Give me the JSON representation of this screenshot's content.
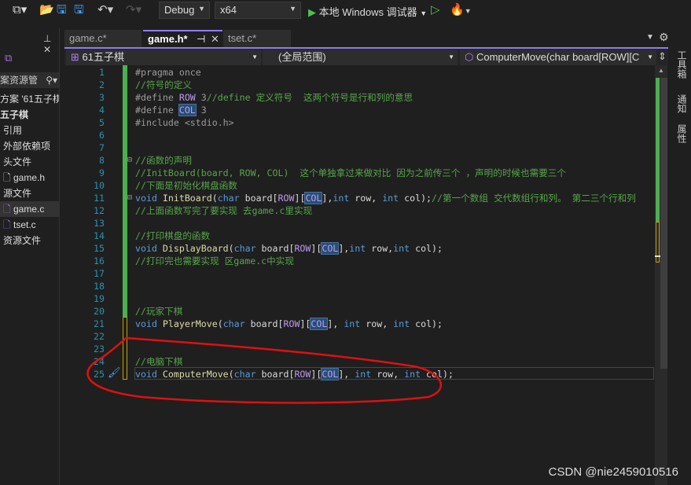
{
  "toolbar": {
    "config": "Debug",
    "platform": "x64",
    "run_label": "本地 Windows 调试器",
    "icons": [
      "new-project-icon",
      "open-folder-icon",
      "save-icon",
      "save-all-icon",
      "undo-icon",
      "redo-icon",
      "play-icon",
      "play-outline-icon",
      "hot-reload-icon"
    ]
  },
  "sidebar": {
    "search_label": "案资源管",
    "items": [
      "方案 '61五子棋",
      "五子棋",
      "引用",
      "外部依赖项",
      "头文件",
      "game.h",
      "源文件",
      "game.c",
      "tset.c",
      "资源文件"
    ]
  },
  "tabs": [
    {
      "label": "game.c*",
      "active": false
    },
    {
      "label": "game.h*",
      "active": true
    },
    {
      "label": "tset.c*",
      "active": false
    }
  ],
  "navbar": {
    "project": "61五子棋",
    "scope": "(全局范围)",
    "member": "ComputerMove(char board[ROW][C"
  },
  "right_panel": [
    "工具箱",
    "通知",
    "属性"
  ],
  "code": [
    [
      [
        "pp",
        "#pragma once"
      ]
    ],
    [
      [
        "cm",
        "//符号的定义"
      ]
    ],
    [
      [
        "pp",
        "#define "
      ],
      [
        "mac",
        "ROW"
      ],
      [
        "pp",
        " 3"
      ],
      [
        "cm",
        "//define 定义符号  这两个符号是行和列的意思"
      ]
    ],
    [
      [
        "pp",
        "#define "
      ],
      [
        "mac hl",
        "COL"
      ],
      [
        "pp",
        " 3"
      ]
    ],
    [
      [
        "pp",
        "#include <stdio.h>"
      ]
    ],
    [],
    [],
    [
      [
        "cm",
        "//函数的声明"
      ]
    ],
    [
      [
        "cm",
        "//InitBoard(board, ROW, COL)  这个单独拿过来做对比 因为之前传三个 ，声明的时候也需要三个"
      ]
    ],
    [
      [
        "cm",
        "//下面是初始化棋盘函数"
      ]
    ],
    [
      [
        "kw",
        "void "
      ],
      [
        "fn",
        "InitBoard"
      ],
      [
        "",
        "("
      ],
      [
        "kw",
        "char"
      ],
      [
        "",
        " board["
      ],
      [
        "mac",
        "ROW"
      ],
      [
        "",
        "]["
      ],
      [
        "mac hl",
        "COL"
      ],
      [
        "",
        "],"
      ],
      [
        "kw",
        "int"
      ],
      [
        "",
        " row, "
      ],
      [
        "kw",
        "int"
      ],
      [
        "",
        " col);"
      ],
      [
        "cm",
        "//第一个数组 交代数组行和列。 第二三个行和列"
      ]
    ],
    [
      [
        "cm",
        "//上面函数写完了要实现 去game.c里实现"
      ]
    ],
    [],
    [
      [
        "cm",
        "//打印棋盘的函数"
      ]
    ],
    [
      [
        "kw",
        "void "
      ],
      [
        "fn",
        "DisplayBoard"
      ],
      [
        "",
        "("
      ],
      [
        "kw",
        "char"
      ],
      [
        "",
        " board["
      ],
      [
        "mac",
        "ROW"
      ],
      [
        "",
        "]["
      ],
      [
        "mac hl",
        "COL"
      ],
      [
        "",
        "],"
      ],
      [
        "kw",
        "int"
      ],
      [
        "",
        " row,"
      ],
      [
        "kw",
        "int"
      ],
      [
        "",
        " col);"
      ]
    ],
    [
      [
        "cm",
        "//打印完也需要实现 区game.c中实现"
      ]
    ],
    [],
    [],
    [],
    [
      [
        "cm",
        "//玩家下棋"
      ]
    ],
    [
      [
        "kw",
        "void "
      ],
      [
        "fn",
        "PlayerMove"
      ],
      [
        "",
        "("
      ],
      [
        "kw",
        "char"
      ],
      [
        "",
        " board["
      ],
      [
        "mac",
        "ROW"
      ],
      [
        "",
        "]["
      ],
      [
        "mac hl",
        "COL"
      ],
      [
        "",
        "], "
      ],
      [
        "kw",
        "int"
      ],
      [
        "",
        " row, "
      ],
      [
        "kw",
        "int"
      ],
      [
        "",
        " col);"
      ]
    ],
    [],
    [],
    [
      [
        "cm",
        "//电脑下棋"
      ]
    ],
    [
      [
        "kw",
        "void "
      ],
      [
        "fn",
        "ComputerMove"
      ],
      [
        "",
        "("
      ],
      [
        "kw",
        "char"
      ],
      [
        "",
        " board["
      ],
      [
        "mac",
        "ROW"
      ],
      [
        "",
        "]["
      ],
      [
        "mac hl",
        "COL"
      ],
      [
        "",
        "], "
      ],
      [
        "kw",
        "int"
      ],
      [
        "",
        " row, "
      ],
      [
        "kw",
        "int"
      ],
      [
        "",
        " col);"
      ]
    ]
  ],
  "watermark": "CSDN @nie2459010516",
  "colors": {
    "accent": "#8e7cf0",
    "change_saved": "#4caf50",
    "change_unsaved": "#c8a000",
    "annotation": "#e01010"
  }
}
